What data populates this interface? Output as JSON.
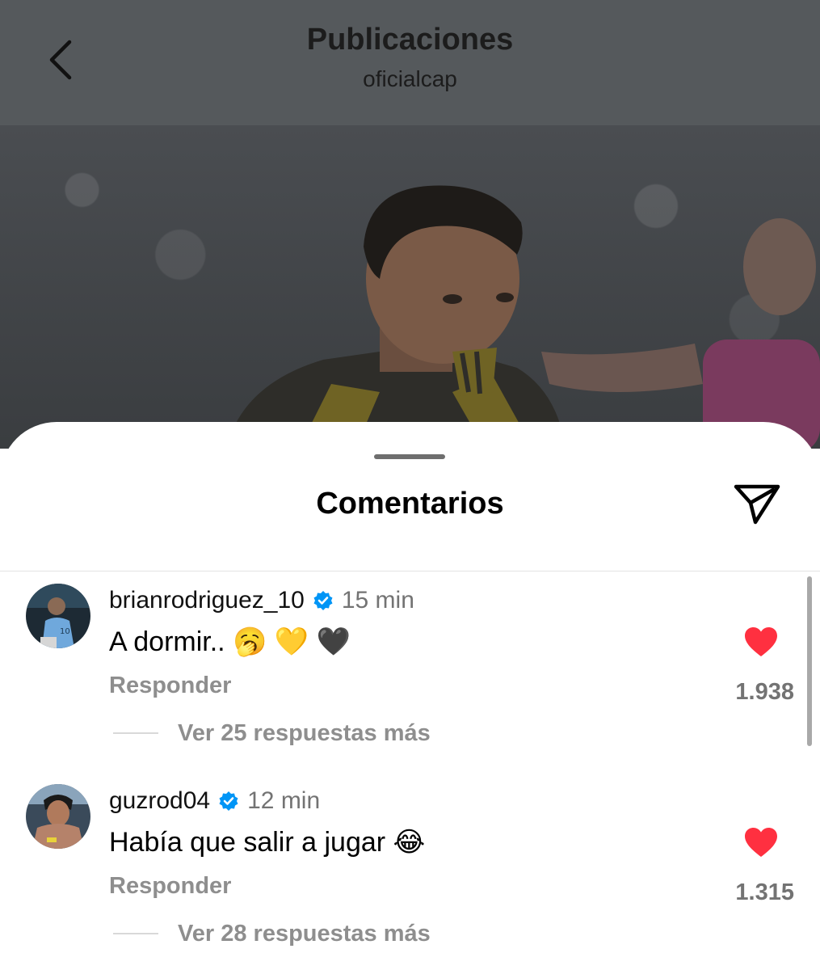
{
  "header": {
    "title": "Publicaciones",
    "subtitle": "oficialcap"
  },
  "sheet": {
    "title": "Comentarios"
  },
  "comments": [
    {
      "username": "brianrodriguez_10",
      "verified": true,
      "time": "15 min",
      "text": "A dormir.. 🥱 💛 🖤",
      "reply_label": "Responder",
      "likes": "1.938",
      "liked": true,
      "more_replies": "Ver 25 respuestas más"
    },
    {
      "username": "guzrod04",
      "verified": true,
      "time": "12 min",
      "text": "Había que salir a jugar 😂",
      "reply_label": "Responder",
      "likes": "1.315",
      "liked": true,
      "more_replies": "Ver 28 respuestas más"
    }
  ],
  "colors": {
    "header_bg": "#55595c",
    "like_red": "#ff3040",
    "verified_blue": "#0095f6",
    "muted_text": "#8e8e8e"
  },
  "icons": {
    "back": "chevron-left-icon",
    "share": "paper-plane-icon",
    "verified": "verified-badge-icon",
    "like": "heart-icon"
  }
}
